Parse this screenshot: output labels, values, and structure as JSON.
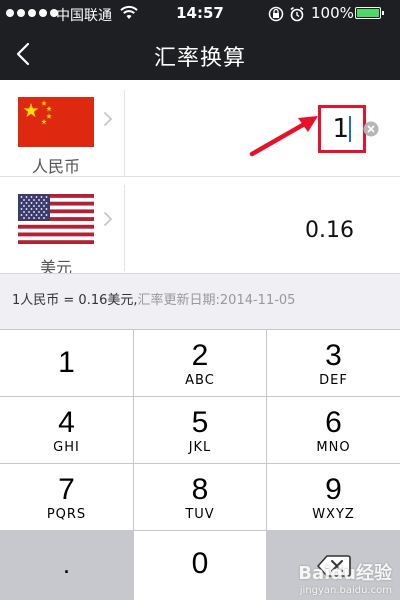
{
  "status_bar": {
    "carrier": "中国联通",
    "time": "14:57",
    "battery_percent": "100%",
    "colors": {
      "background": "#1e1f23",
      "battery_fill": "#4cd964"
    }
  },
  "nav_bar": {
    "title": "汇率换算",
    "back_icon": "chevron-left-icon"
  },
  "currencies": [
    {
      "name": "人民币",
      "flag": "china-flag-icon",
      "amount": "1"
    },
    {
      "name": "美元",
      "flag": "usa-flag-icon",
      "amount": "0.16"
    }
  ],
  "rate_info": {
    "rate_text": "1人民币 = 0.16美元,",
    "date_text": "汇率更新日期:2014-11-05"
  },
  "keypad": {
    "keys": [
      {
        "digit": "1",
        "letters": ""
      },
      {
        "digit": "2",
        "letters": "ABC"
      },
      {
        "digit": "3",
        "letters": "DEF"
      },
      {
        "digit": "4",
        "letters": "GHI"
      },
      {
        "digit": "5",
        "letters": "JKL"
      },
      {
        "digit": "6",
        "letters": "MNO"
      },
      {
        "digit": "7",
        "letters": "PQRS"
      },
      {
        "digit": "8",
        "letters": "TUV"
      },
      {
        "digit": "9",
        "letters": "WXYZ"
      },
      {
        "digit": ".",
        "letters": ""
      },
      {
        "digit": "0",
        "letters": ""
      }
    ],
    "backspace_icon": "backspace-icon"
  },
  "watermark": {
    "main": "Baidu经验",
    "sub": "jingyan.baidu.com"
  },
  "accent_colors": {
    "highlight_box": "#e8112a",
    "caret": "#1b6cd6"
  }
}
